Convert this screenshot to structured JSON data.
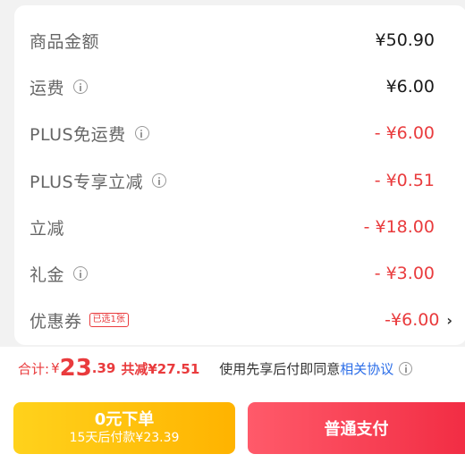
{
  "rows": [
    {
      "label": "商品金额",
      "value": "¥50.90"
    },
    {
      "label": "运费",
      "value": "¥6.00"
    },
    {
      "label": "PLUS免运费",
      "value": "- ¥6.00"
    },
    {
      "label": "PLUS专享立减",
      "value": "- ¥0.51"
    },
    {
      "label": "立减",
      "value": "- ¥18.00"
    },
    {
      "label": "礼金",
      "value": "- ¥3.00"
    },
    {
      "label": "优惠券",
      "value": "-¥6.00",
      "badge": "已选1张",
      "chevron": "›"
    }
  ],
  "summary": {
    "total_label": "合计:",
    "yen": "¥",
    "total_int": "23",
    "total_dec": ".39",
    "savings": "共减¥27.51",
    "agree_text": "使用先享后付即同意",
    "agree_link": "相关协议"
  },
  "buttons": {
    "credit_title": "0元下单",
    "credit_sub": "15天后付款¥23.39",
    "pay_label": "普通支付"
  },
  "colors": {
    "accent_red": "#e93b3d",
    "link_blue": "#2c6ee8",
    "yellow": "#ffc107"
  }
}
